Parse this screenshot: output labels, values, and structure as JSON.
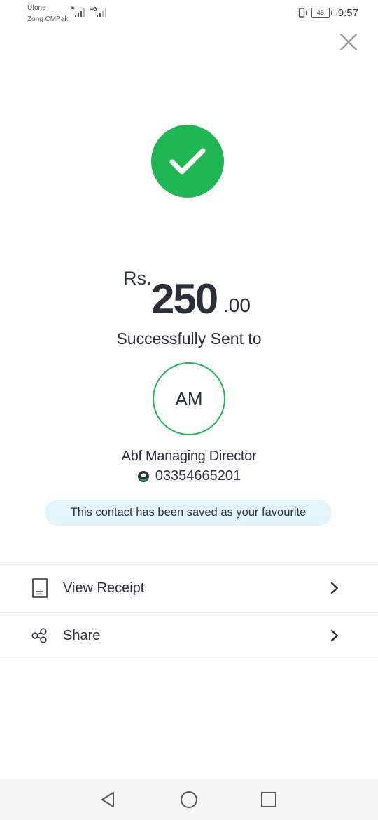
{
  "status_bar": {
    "carrier_1": "Ufone",
    "carrier_2": "Zong CMPak",
    "network_1": "E",
    "network_2": "4G",
    "battery": "45",
    "time": "9:57"
  },
  "amount": {
    "currency": "Rs.",
    "whole": "250",
    "decimal": ".00"
  },
  "status_message": "Successfully Sent to",
  "recipient": {
    "initials": "AM",
    "name": "Abf Managing Director",
    "number": "03354665201"
  },
  "favourite_notice": "This contact has been saved as your favourite",
  "actions": [
    {
      "label": "View Receipt",
      "icon": "receipt-icon"
    },
    {
      "label": "Share",
      "icon": "share-icon"
    }
  ],
  "colors": {
    "success_green": "#1fb553",
    "banner_bg": "#e4f4fb",
    "text_dark": "#2b2f3a"
  }
}
